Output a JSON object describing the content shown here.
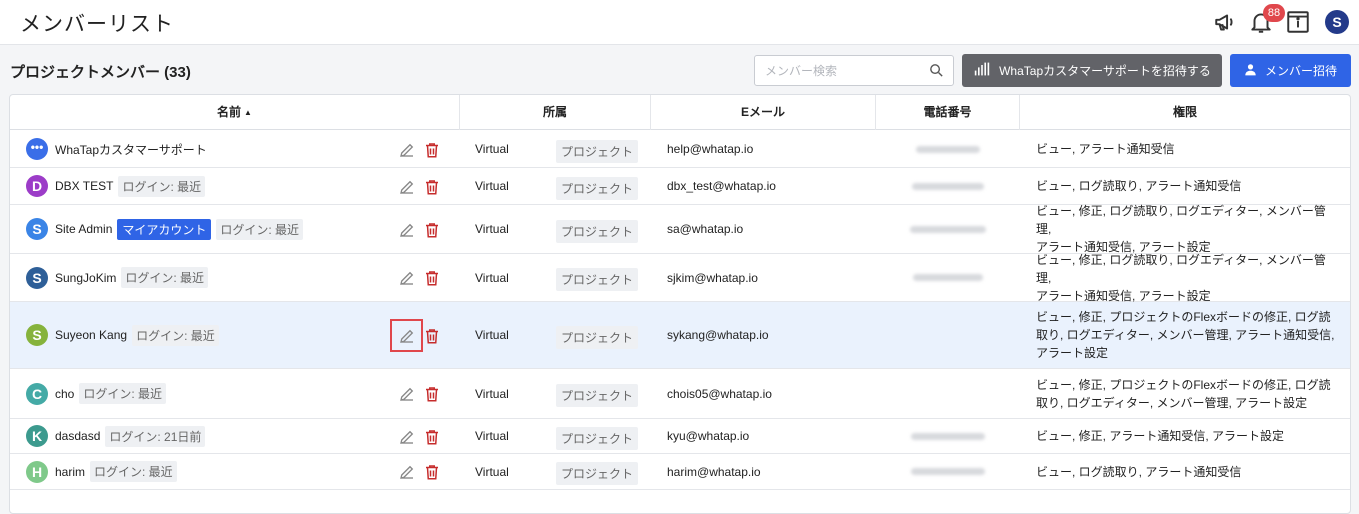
{
  "header": {
    "title": "メンバーリスト",
    "notification_count": "88",
    "user_initial": "S"
  },
  "section": {
    "title": "プロジェクトメンバー (33)"
  },
  "search": {
    "placeholder": "メンバー検索"
  },
  "buttons": {
    "support_invite": "WhaTapカスタマーサポートを招待する",
    "member_invite": "メンバー招待"
  },
  "table": {
    "columns": [
      "名前",
      "所属",
      "Eメール",
      "電話番号",
      "権限"
    ],
    "rows": [
      {
        "initial": "•••",
        "avatar_color": "#3a6ee8",
        "name": "WhaTapカスタマーサポート",
        "my_account": "",
        "login": "",
        "affiliation": "Virtual",
        "affiliation_tag": "プロジェクト",
        "email": "help@whatap.io",
        "perm1": "ビュー, アラート通知受信",
        "perm2": "",
        "perm3": ""
      },
      {
        "initial": "D",
        "avatar_color": "#9c3cc8",
        "name": "DBX TEST",
        "my_account": "",
        "login": "ログイン: 最近",
        "affiliation": "Virtual",
        "affiliation_tag": "プロジェクト",
        "email": "dbx_test@whatap.io",
        "perm1": "ビュー, ログ読取り, アラート通知受信",
        "perm2": "",
        "perm3": ""
      },
      {
        "initial": "S",
        "avatar_color": "#3a84e6",
        "name": "Site Admin",
        "my_account": "マイアカウント",
        "login": "ログイン: 最近",
        "affiliation": "Virtual",
        "affiliation_tag": "プロジェクト",
        "email": "sa@whatap.io",
        "perm1": "ビュー, 修正, ログ読取り, ログエディター, メンバー管理,",
        "perm2": "アラート通知受信, アラート設定",
        "perm3": ""
      },
      {
        "initial": "S",
        "avatar_color": "#2e5f98",
        "name": "SungJoKim",
        "my_account": "",
        "login": "ログイン: 最近",
        "affiliation": "Virtual",
        "affiliation_tag": "プロジェクト",
        "email": "sjkim@whatap.io",
        "perm1": "ビュー, 修正, ログ読取り, ログエディター, メンバー管理,",
        "perm2": "アラート通知受信, アラート設定",
        "perm3": ""
      },
      {
        "initial": "S",
        "avatar_color": "#86b33c",
        "name": "Suyeon Kang",
        "my_account": "",
        "login": "ログイン: 最近",
        "affiliation": "Virtual",
        "affiliation_tag": "プロジェクト",
        "email": "sykang@whatap.io",
        "perm1": "ビュー, 修正, プロジェクトのFlexボードの修正, ログ読",
        "perm2": "取り, ログエディター, メンバー管理, アラート通知受信,",
        "perm3": "アラート設定"
      },
      {
        "initial": "C",
        "avatar_color": "#44aaa6",
        "name": "cho",
        "my_account": "",
        "login": "ログイン: 最近",
        "affiliation": "Virtual",
        "affiliation_tag": "プロジェクト",
        "email": "chois05@whatap.io",
        "perm1": "ビュー, 修正, プロジェクトのFlexボードの修正, ログ読",
        "perm2": "取り, ログエディター, メンバー管理, アラート設定",
        "perm3": ""
      },
      {
        "initial": "K",
        "avatar_color": "#3c9a8e",
        "name": "dasdasd",
        "my_account": "",
        "login": "ログイン: 21日前",
        "affiliation": "Virtual",
        "affiliation_tag": "プロジェクト",
        "email": "kyu@whatap.io",
        "perm1": "ビュー, 修正, アラート通知受信, アラート設定",
        "perm2": "",
        "perm3": ""
      },
      {
        "initial": "H",
        "avatar_color": "#7fc98a",
        "name": "harim",
        "my_account": "",
        "login": "ログイン: 最近",
        "affiliation": "Virtual",
        "affiliation_tag": "プロジェクト",
        "email": "harim@whatap.io",
        "perm1": "ビュー, ログ読取り, アラート通知受信",
        "perm2": "",
        "perm3": ""
      }
    ]
  }
}
